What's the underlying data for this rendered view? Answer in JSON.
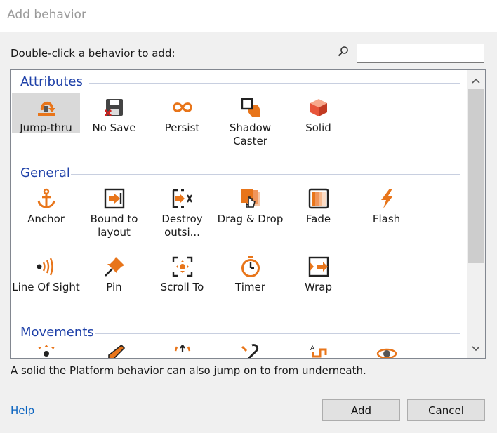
{
  "window": {
    "title": "Add behavior"
  },
  "prompt": "Double-click a behavior to add:",
  "search": {
    "value": "",
    "placeholder": ""
  },
  "groups": [
    {
      "name": "Attributes",
      "items": [
        {
          "label": "Jump-thru",
          "icon": "jump-thru-icon",
          "selected": true
        },
        {
          "label": "No Save",
          "icon": "no-save-icon"
        },
        {
          "label": "Persist",
          "icon": "persist-icon"
        },
        {
          "label": "Shadow Caster",
          "icon": "shadow-caster-icon"
        },
        {
          "label": "Solid",
          "icon": "solid-icon"
        }
      ]
    },
    {
      "name": "General",
      "items": [
        {
          "label": "Anchor",
          "icon": "anchor-icon"
        },
        {
          "label": "Bound to layout",
          "icon": "bound-to-layout-icon"
        },
        {
          "label": "Destroy outsi...",
          "icon": "destroy-outside-icon"
        },
        {
          "label": "Drag & Drop",
          "icon": "drag-drop-icon"
        },
        {
          "label": "Fade",
          "icon": "fade-icon"
        },
        {
          "label": "Flash",
          "icon": "flash-icon"
        },
        {
          "label": "Line Of Sight",
          "icon": "line-of-sight-icon"
        },
        {
          "label": "Pin",
          "icon": "pin-icon"
        },
        {
          "label": "Scroll To",
          "icon": "scroll-to-icon"
        },
        {
          "label": "Timer",
          "icon": "timer-icon"
        },
        {
          "label": "Wrap",
          "icon": "wrap-icon"
        }
      ]
    },
    {
      "name": "Movements",
      "items": [
        {
          "label": "",
          "icon": "movement-8dir-icon"
        },
        {
          "label": "",
          "icon": "bullet-icon"
        },
        {
          "label": "",
          "icon": "car-icon"
        },
        {
          "label": "",
          "icon": "custom-movement-icon"
        },
        {
          "label": "",
          "icon": "pathfinding-icon"
        },
        {
          "label": "",
          "icon": "physics-icon"
        }
      ]
    }
  ],
  "description": "A solid the Platform behavior can also jump on to from underneath.",
  "help_label": "Help",
  "buttons": {
    "add": "Add",
    "cancel": "Cancel"
  },
  "colors": {
    "accent_orange": "#e8751a",
    "group_blue": "#1e40a8",
    "link_blue": "#0b64c0"
  }
}
